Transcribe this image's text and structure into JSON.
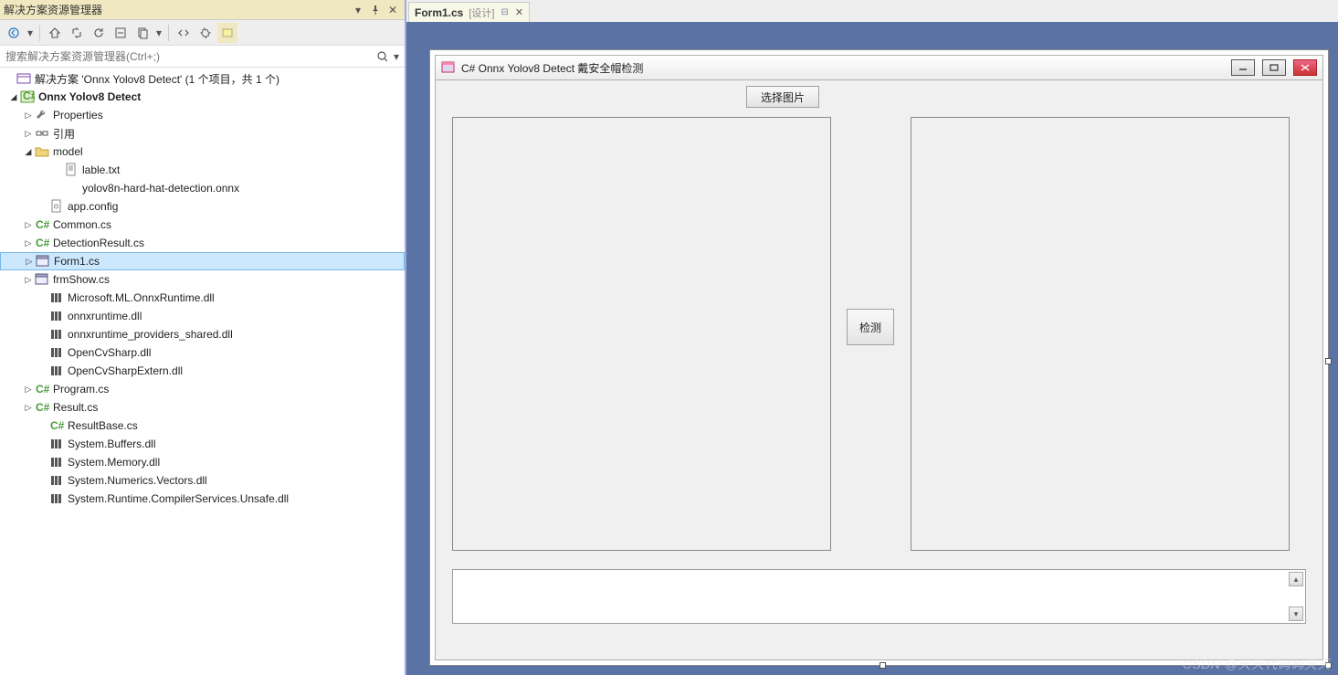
{
  "explorer": {
    "title": "解决方案资源管理器",
    "search_placeholder": "搜索解决方案资源管理器(Ctrl+;)",
    "solution_label": "解决方案 'Onnx Yolov8 Detect' (1 个项目，共 1 个)",
    "project_label": "Onnx Yolov8 Detect",
    "nodes": {
      "properties": "Properties",
      "references": "引用",
      "model": "model",
      "lable_txt": "lable.txt",
      "onnx_model": "yolov8n-hard-hat-detection.onnx",
      "app_config": "app.config",
      "common_cs": "Common.cs",
      "detectionresult_cs": "DetectionResult.cs",
      "form1_cs": "Form1.cs",
      "frmshow_cs": "frmShow.cs",
      "ms_onnxruntime": "Microsoft.ML.OnnxRuntime.dll",
      "onnxruntime": "onnxruntime.dll",
      "onnxruntime_prov": "onnxruntime_providers_shared.dll",
      "opencvsharp": "OpenCvSharp.dll",
      "opencvsharpextern": "OpenCvSharpExtern.dll",
      "program_cs": "Program.cs",
      "result_cs": "Result.cs",
      "resultbase_cs": "ResultBase.cs",
      "sysbuffers": "System.Buffers.dll",
      "sysmemory": "System.Memory.dll",
      "sysnumerics": "System.Numerics.Vectors.dll",
      "sysruntime": "System.Runtime.CompilerServices.Unsafe.dll"
    }
  },
  "editor": {
    "tab_name": "Form1.cs",
    "tab_suffix": "[设计]"
  },
  "form": {
    "title": "C# Onnx Yolov8 Detect 戴安全帽检测",
    "btn_select_image": "选择图片",
    "btn_detect": "检测"
  },
  "watermark": "CSDN @天天代码码天天"
}
